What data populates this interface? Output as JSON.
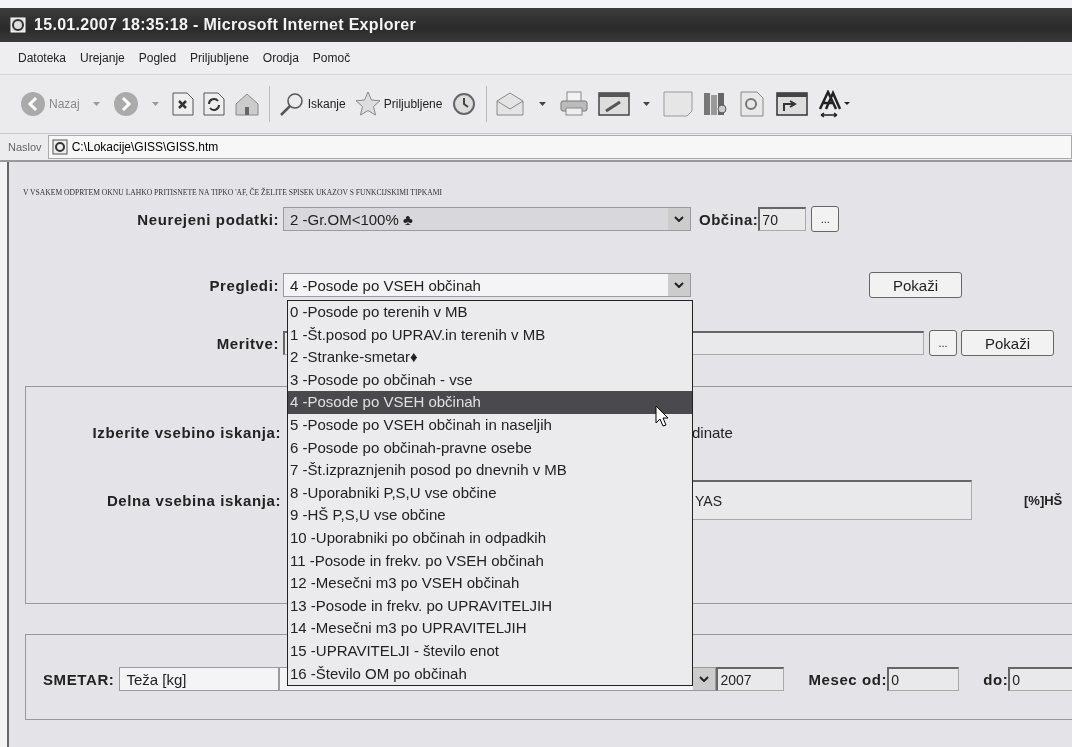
{
  "window": {
    "title": "15.01.2007 18:35:18 - Microsoft Internet Explorer"
  },
  "menu": [
    "Datoteka",
    "Urejanje",
    "Pogled",
    "Priljubljene",
    "Orodja",
    "Pomoč"
  ],
  "toolbar": {
    "back_label": "Nazaj",
    "search_label": "Iskanje",
    "favorites_label": "Priljubljene"
  },
  "address": {
    "label": "Naslov",
    "value": "C:\\Lokacije\\GISS\\GISS.htm"
  },
  "notice": "V VSAKEM ODPRTEM OKNU LAHKO PRITISNETE NA TIPKO 'AF, ČE ŽELITE SPISEK UKAZOV S FUNKCIJSKIMI TIPKAMI",
  "neurejeni": {
    "label": "Neurejeni podatki:",
    "value": "2 -Gr.OM<100% ♣"
  },
  "obcina": {
    "label": "Občina:",
    "value": "70",
    "button": "..."
  },
  "pregledi": {
    "label": "Pregledi:",
    "value": "4 -Posode po VSEH občinah",
    "button": "Pokaži",
    "open": true,
    "options": [
      {
        "label": "0 -Posode po terenih v MB",
        "selected": false
      },
      {
        "label": "1 -Št.posod po UPRAV.in terenih v MB",
        "selected": false
      },
      {
        "label": "2 -Stranke-smetar♦",
        "selected": false
      },
      {
        "label": "3 -Posode po občinah - vse",
        "selected": false
      },
      {
        "label": "4 -Posode po VSEH občinah",
        "selected": true
      },
      {
        "label": "5 -Posode po VSEH občinah in naseljih",
        "selected": false
      },
      {
        "label": "6 -Posode po občinah-pravne osebe",
        "selected": false
      },
      {
        "label": "7 -Št.izpraznjenih posod po dnevnih v MB",
        "selected": false
      },
      {
        "label": "8 -Uporabniki P,S,U vse občine",
        "selected": false
      },
      {
        "label": "9 -HŠ P,S,U vse občine",
        "selected": false
      },
      {
        "label": "10 -Uporabniki po občinah in odpadkih",
        "selected": false
      },
      {
        "label": "11 -Posode in frekv. po VSEH občinah",
        "selected": false
      },
      {
        "label": "12 -Mesečni m3 po VSEH občinah",
        "selected": false
      },
      {
        "label": "13 -Posode in frekv. po UPRAVITELJIH",
        "selected": false
      },
      {
        "label": "14 -Mesečni m3 po UPRAVITELJIH",
        "selected": false
      },
      {
        "label": "15 -UPRAVITELJI - število enot",
        "selected": false
      },
      {
        "label": "16 -Število OM po občinah",
        "selected": false
      }
    ]
  },
  "meritve": {
    "label": "Meritve:",
    "browse": "...",
    "button": "Pokaži"
  },
  "search_panel": {
    "izberite_label": "Izberite vsebino iskanja:",
    "option_partial": "dinate",
    "delna_label": "Delna vsebina iskanja:",
    "delna_value": "YAS",
    "suffix": "[%]HŠ"
  },
  "smetar": {
    "label": "SMETAR:",
    "unit": "Teža [kg]",
    "year": "2007",
    "mesec_od_label": "Mesec od:",
    "mesec_od": "0",
    "do_label": "do:",
    "do": "0"
  }
}
